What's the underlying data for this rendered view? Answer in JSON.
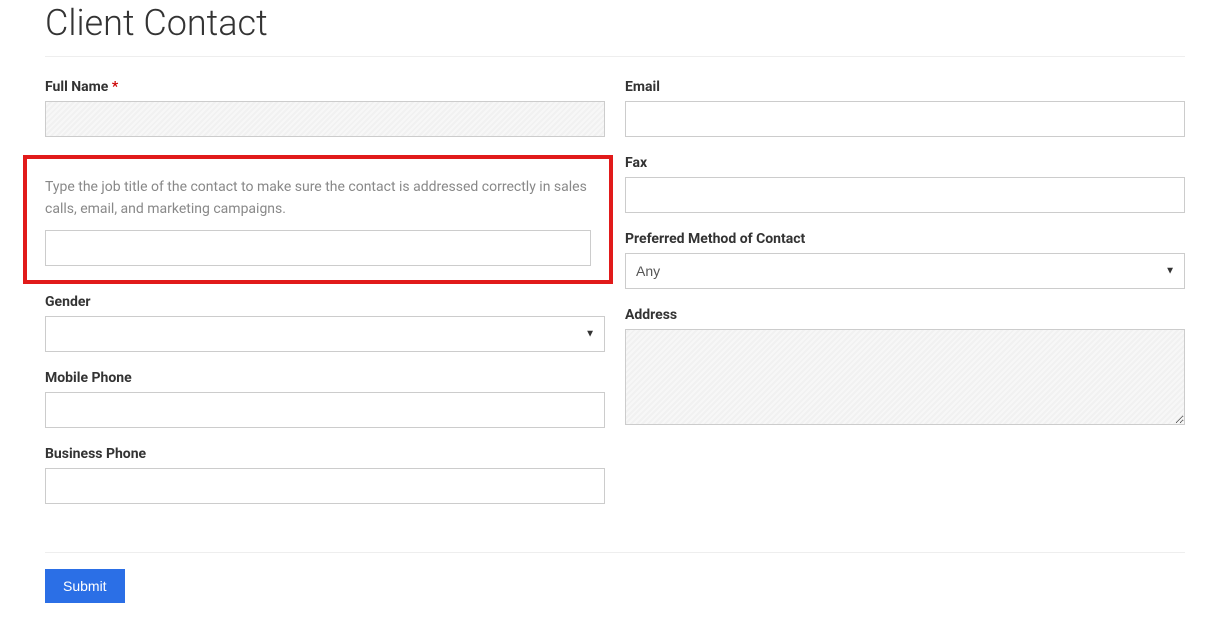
{
  "title": "Client Contact",
  "left": {
    "full_name": {
      "label": "Full Name",
      "required_mark": "*",
      "value": ""
    },
    "job_title": {
      "description": "Type the job title of the contact to make sure the contact is addressed correctly in sales calls, email, and marketing campaigns.",
      "value": ""
    },
    "gender": {
      "label": "Gender",
      "value": ""
    },
    "mobile_phone": {
      "label": "Mobile Phone",
      "value": ""
    },
    "business_phone": {
      "label": "Business Phone",
      "value": ""
    }
  },
  "right": {
    "email": {
      "label": "Email",
      "value": ""
    },
    "fax": {
      "label": "Fax",
      "value": ""
    },
    "preferred_contact": {
      "label": "Preferred Method of Contact",
      "selected": "Any"
    },
    "address": {
      "label": "Address",
      "value": ""
    }
  },
  "submit_label": "Submit"
}
